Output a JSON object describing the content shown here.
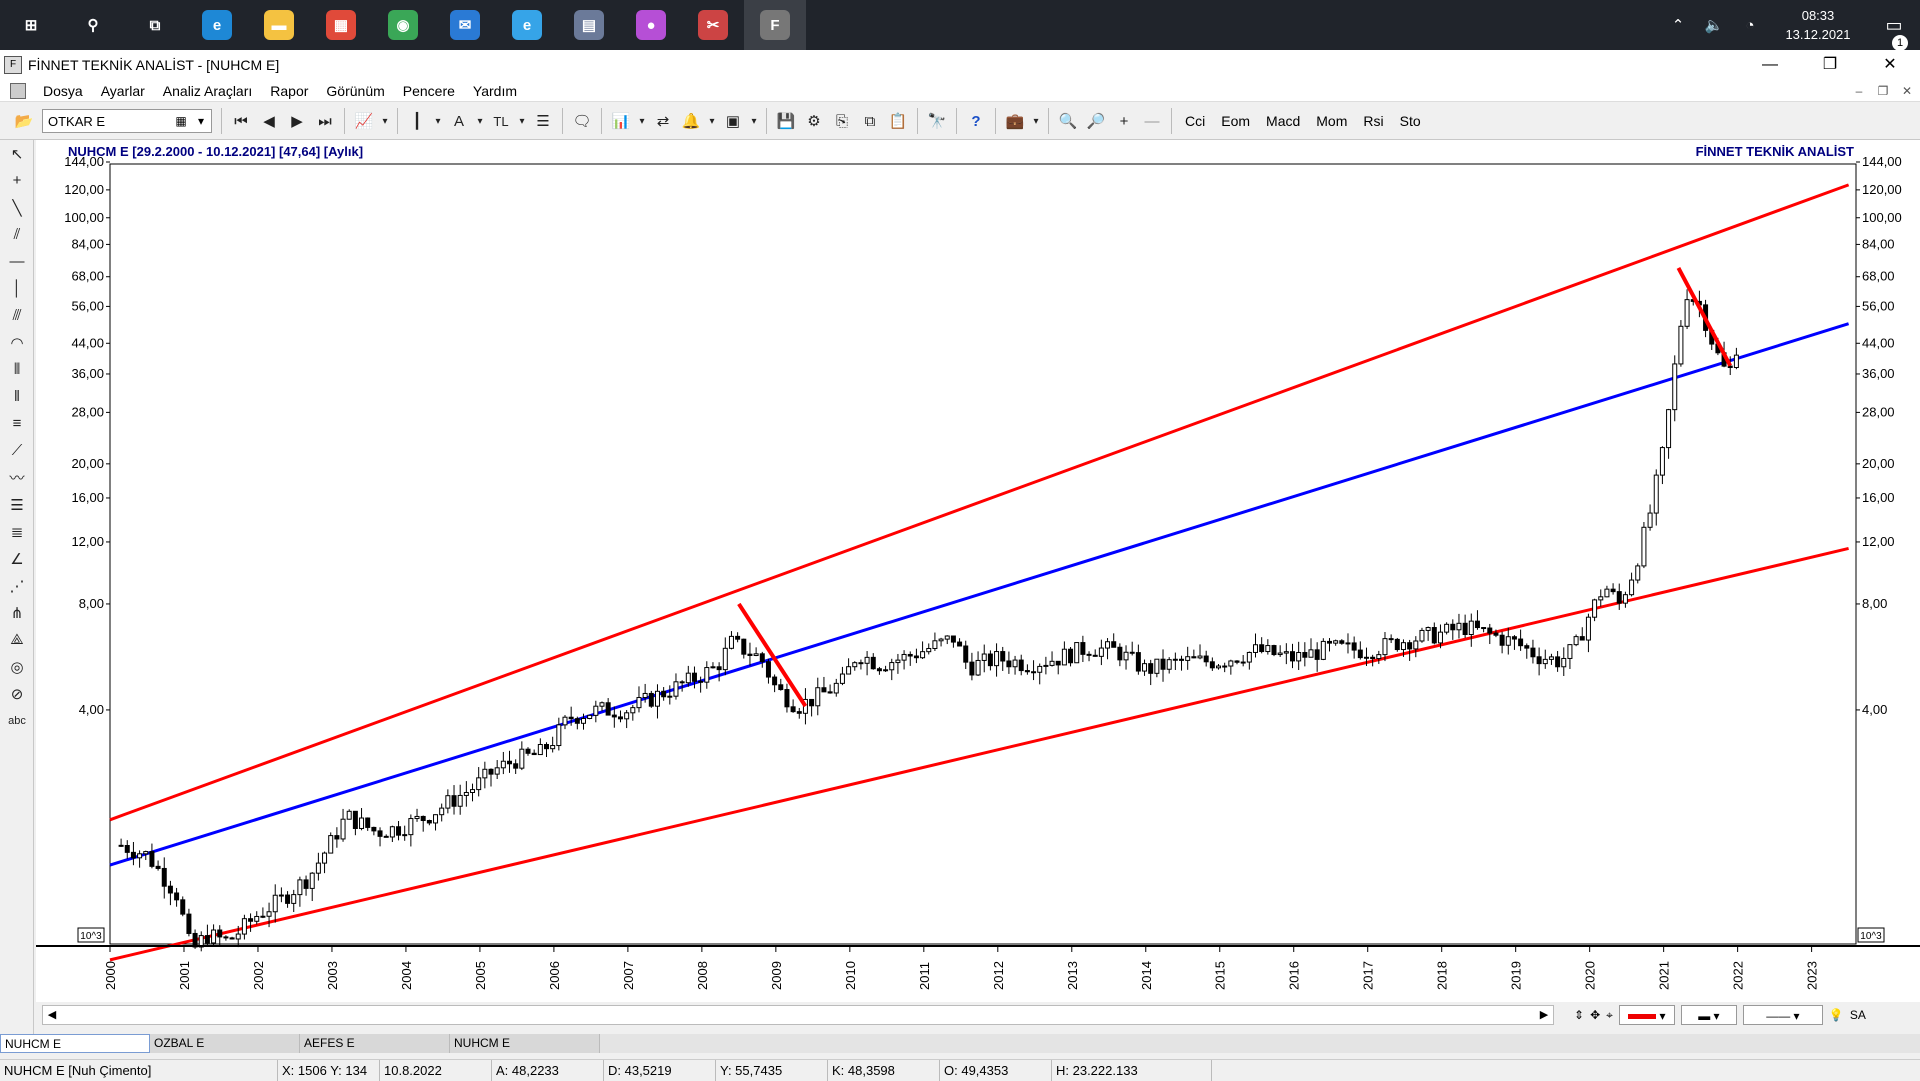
{
  "taskbar": {
    "apps": [
      {
        "name": "windows-start",
        "glyph": "⊞"
      },
      {
        "name": "search",
        "glyph": "⚲"
      },
      {
        "name": "task-view",
        "glyph": "⧉"
      },
      {
        "name": "edge",
        "glyph": "e",
        "color": "#1e88d6"
      },
      {
        "name": "file-explorer",
        "glyph": "▬",
        "color": "#f4c241"
      },
      {
        "name": "store",
        "glyph": "▦",
        "color": "#e04a3a"
      },
      {
        "name": "chrome",
        "glyph": "◉",
        "color": "#3aa757"
      },
      {
        "name": "mail",
        "glyph": "✉",
        "color": "#2a7ad5"
      },
      {
        "name": "internet-explorer",
        "glyph": "e",
        "color": "#36a4e8"
      },
      {
        "name": "calculator",
        "glyph": "▤",
        "color": "#6b7a99"
      },
      {
        "name": "paint-drop",
        "glyph": "●",
        "color": "#b64fd6"
      },
      {
        "name": "snipping",
        "glyph": "✂",
        "color": "#cc4444"
      },
      {
        "name": "finnet-app",
        "glyph": "F",
        "color": "#777"
      }
    ],
    "clock_time": "08:33",
    "clock_date": "13.12.2021",
    "notification_count": "1"
  },
  "window": {
    "title": "FİNNET TEKNİK ANALİST - [NUHCM E]"
  },
  "menu": [
    "Dosya",
    "Ayarlar",
    "Analiz Araçları",
    "Rapor",
    "Görünüm",
    "Pencere",
    "Yardım"
  ],
  "toolbar": {
    "symbol": "OTKAR E",
    "currency": "TL",
    "font_btn": "A",
    "indicators": [
      "Cci",
      "Eom",
      "Macd",
      "Mom",
      "Rsi",
      "Sto"
    ]
  },
  "chart": {
    "header_left": "NUHCM E  [29.2.2000 - 10.12.2021]  [47,64]  [Aylık]",
    "header_right": "FİNNET TEKNİK ANALİST",
    "scale_label": "10^3"
  },
  "chart_data": {
    "type": "candlestick",
    "title": "NUHCM E  [29.2.2000 - 10.12.2021]  [47,64]  [Aylık]",
    "y_scale": "log",
    "y_ticks": [
      4,
      8,
      12,
      16,
      20,
      28,
      36,
      44,
      56,
      68,
      84,
      100,
      120,
      144
    ],
    "y_tick_labels": [
      "4,00",
      "8,00",
      "12,00",
      "16,00",
      "20,00",
      "28,00",
      "36,00",
      "44,00",
      "56,00",
      "68,00",
      "84,00",
      "100,00",
      "120,00",
      "144,00"
    ],
    "x_ticks": [
      "2000",
      "2001",
      "2002",
      "2003",
      "2004",
      "2005",
      "2006",
      "2007",
      "2008",
      "2009",
      "2010",
      "2011",
      "2012",
      "2013",
      "2014",
      "2015",
      "2016",
      "2017",
      "2018",
      "2019",
      "2020",
      "2021",
      "2022",
      "2023"
    ],
    "close_path": [
      [
        2000.15,
        1.65
      ],
      [
        2000.5,
        1.55
      ],
      [
        2000.9,
        1.2
      ],
      [
        2001.0,
        1.0
      ],
      [
        2001.1,
        0.82
      ],
      [
        2001.3,
        0.92
      ],
      [
        2001.6,
        0.88
      ],
      [
        2002.0,
        1.05
      ],
      [
        2002.3,
        1.15
      ],
      [
        2002.7,
        1.35
      ],
      [
        2003.0,
        1.7
      ],
      [
        2003.2,
        2.0
      ],
      [
        2003.6,
        1.8
      ],
      [
        2003.9,
        1.85
      ],
      [
        2004.3,
        2.0
      ],
      [
        2004.6,
        2.2
      ],
      [
        2004.9,
        2.4
      ],
      [
        2005.2,
        2.7
      ],
      [
        2005.5,
        2.9
      ],
      [
        2005.8,
        3.0
      ],
      [
        2006.0,
        3.3
      ],
      [
        2006.2,
        3.8
      ],
      [
        2006.6,
        4.0
      ],
      [
        2007.0,
        4.0
      ],
      [
        2007.4,
        4.4
      ],
      [
        2007.8,
        4.8
      ],
      [
        2008.2,
        5.3
      ],
      [
        2008.4,
        6.2
      ],
      [
        2008.8,
        5.6
      ],
      [
        2009.0,
        4.6
      ],
      [
        2009.3,
        4.1
      ],
      [
        2009.6,
        4.4
      ],
      [
        2009.9,
        4.8
      ],
      [
        2010.1,
        5.8
      ],
      [
        2010.4,
        5.4
      ],
      [
        2010.7,
        5.6
      ],
      [
        2011.0,
        5.9
      ],
      [
        2011.4,
        6.4
      ],
      [
        2011.6,
        5.3
      ],
      [
        2012.0,
        5.6
      ],
      [
        2012.4,
        5.4
      ],
      [
        2012.8,
        5.6
      ],
      [
        2013.2,
        6.0
      ],
      [
        2013.6,
        5.9
      ],
      [
        2014.0,
        5.2
      ],
      [
        2014.5,
        5.5
      ],
      [
        2015.0,
        5.5
      ],
      [
        2015.5,
        5.9
      ],
      [
        2016.0,
        5.6
      ],
      [
        2016.5,
        6.0
      ],
      [
        2017.0,
        5.9
      ],
      [
        2017.5,
        6.3
      ],
      [
        2018.0,
        6.6
      ],
      [
        2018.3,
        6.9
      ],
      [
        2018.7,
        6.5
      ],
      [
        2019.0,
        6.2
      ],
      [
        2019.3,
        5.7
      ],
      [
        2019.6,
        5.5
      ],
      [
        2019.8,
        6.0
      ],
      [
        2020.0,
        7.5
      ],
      [
        2020.2,
        9.0
      ],
      [
        2020.4,
        8.0
      ],
      [
        2020.6,
        10.0
      ],
      [
        2020.8,
        14.0
      ],
      [
        2021.0,
        22.0
      ],
      [
        2021.2,
        45.0
      ],
      [
        2021.3,
        62.0
      ],
      [
        2021.5,
        56.0
      ],
      [
        2021.7,
        42.0
      ],
      [
        2021.85,
        36.0
      ],
      [
        2021.95,
        38.0
      ],
      [
        2022.0,
        46.0
      ]
    ],
    "channel": {
      "upper": [
        [
          2000.0,
          1.95
        ],
        [
          2023.5,
          124.0
        ]
      ],
      "middle": [
        [
          2000.0,
          1.45
        ],
        [
          2023.5,
          50.0
        ]
      ],
      "lower": [
        [
          2000.0,
          0.78
        ],
        [
          2023.5,
          11.5
        ]
      ]
    },
    "trend_segments": [
      [
        [
          2008.5,
          8.0
        ],
        [
          2009.4,
          4.1
        ]
      ],
      [
        [
          2021.2,
          72.0
        ],
        [
          2021.9,
          38.0
        ]
      ]
    ],
    "colors": {
      "upper": "#ff0000",
      "middle": "#0000ff",
      "lower": "#ff0000",
      "segments": "#ff0000",
      "candles": "#000000"
    }
  },
  "scroll_controls": {
    "line_label": "SA"
  },
  "tabs": [
    "NUHCM E",
    "OZBAL E",
    "AEFES E",
    "NUHCM E"
  ],
  "status": [
    "NUHCM E [Nuh Çimento]",
    "X: 1506 Y: 134",
    "10.8.2022",
    "A: 48,2233",
    "D: 43,5219",
    "Y: 55,7435",
    "K: 48,3598",
    "O: 49,4353",
    "H: 23.222.133"
  ]
}
